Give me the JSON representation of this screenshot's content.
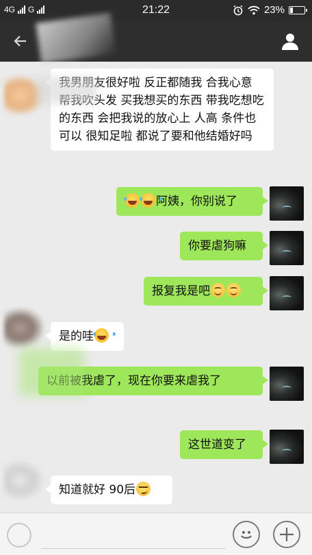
{
  "status_bar": {
    "network_1": "4G",
    "network_2": "G",
    "time": "21:22",
    "battery_percent": "23%",
    "battery_level": 0.23
  },
  "header": {
    "back_icon": "back-arrow-icon",
    "profile_icon": "person-icon"
  },
  "messages": [
    {
      "side": "in",
      "parts": [
        {
          "t": "我男朋友很好啦 反正都随我 合我心意 帮我吹头发 买我想买的东西 带我吃想吃的东西 会把我说的放心上 人高 条件也可以 很知足啦 都说了要和他结婚好吗"
        }
      ]
    },
    {
      "side": "out",
      "parts": [
        {
          "e": "laugh-cry"
        },
        {
          "e": "laugh-cry"
        },
        {
          "t": "阿姨，你别说了"
        }
      ]
    },
    {
      "side": "out",
      "parts": [
        {
          "t": "你要虐狗嘛"
        }
      ]
    },
    {
      "side": "out",
      "parts": [
        {
          "t": "报复我是吧"
        },
        {
          "e": "smile"
        },
        {
          "e": "smile"
        }
      ]
    },
    {
      "side": "in",
      "parts": [
        {
          "t": "是的哇"
        },
        {
          "e": "laugh-cry"
        }
      ]
    },
    {
      "side": "out",
      "parts": [
        {
          "t": "以前被我虐了，现在你要来虐我了"
        }
      ]
    },
    {
      "side": "out",
      "parts": [
        {
          "t": "这世道变了"
        }
      ]
    },
    {
      "side": "in",
      "parts": [
        {
          "t": "知道就好 90后"
        },
        {
          "e": "smirk"
        }
      ]
    }
  ],
  "input_bar": {
    "voice_icon": "voice-icon",
    "input_value": "",
    "emoji_icon": "emoji-icon",
    "plus_icon": "plus-icon"
  }
}
